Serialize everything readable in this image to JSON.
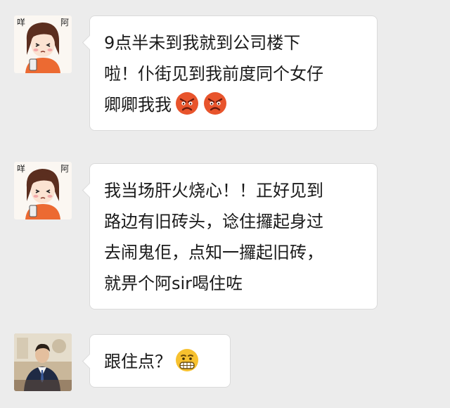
{
  "messages": [
    {
      "sender": "girl",
      "avatar_text": "咩 阿",
      "lines": [
        "9点半未到我就到公司楼下",
        "啦！仆街见到我前度同个女仔",
        "卿卿我我"
      ],
      "emojis": [
        "angry-face-icon",
        "angry-face-icon"
      ]
    },
    {
      "sender": "girl",
      "avatar_text": "咩 阿",
      "lines": [
        "我当场肝火烧心！！正好见到",
        "路边有旧砖头，谂住攞起身过",
        "去闹鬼佢，点知一攞起旧砖，",
        "就畀个阿sir喝住咗"
      ]
    },
    {
      "sender": "man",
      "lines": [
        "跟住点？"
      ],
      "emojis": [
        "grimacing-face-icon"
      ]
    }
  ],
  "colors": {
    "background": "#ececec",
    "bubble": "#ffffff",
    "bubble_border": "#dadada",
    "angry_emoji": "#e8542c",
    "grin_emoji": "#f7c12f"
  }
}
